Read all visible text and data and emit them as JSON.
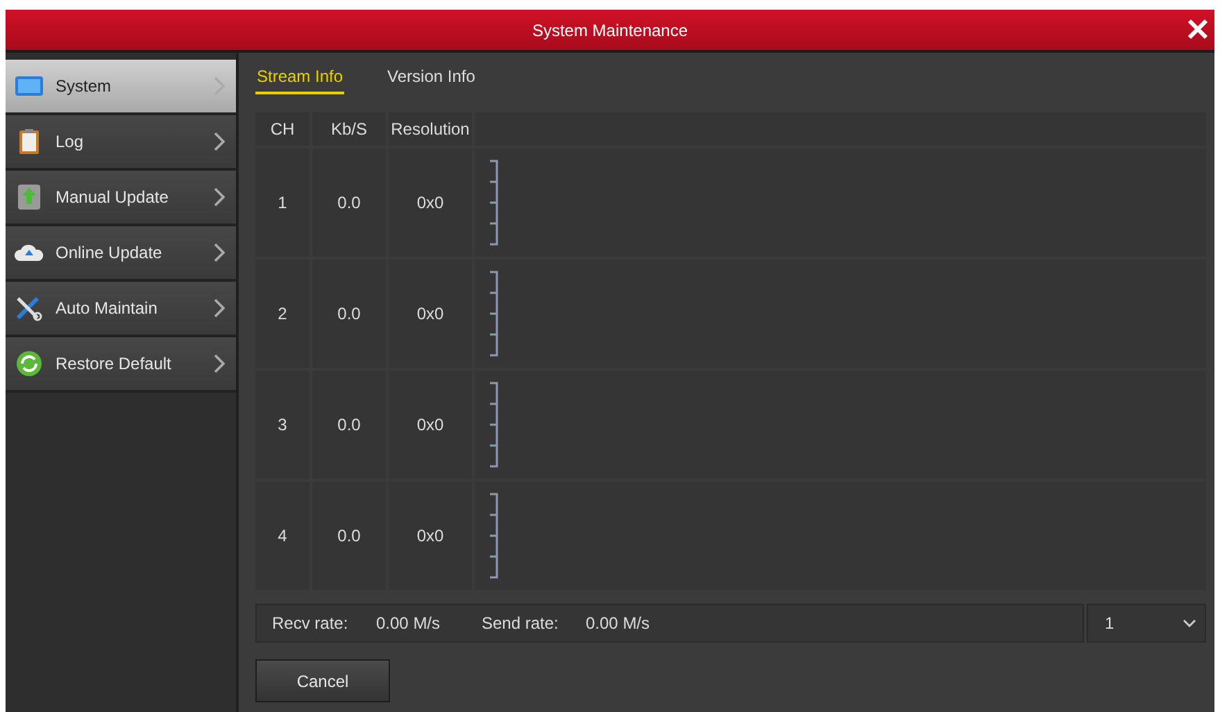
{
  "window": {
    "title": "System Maintenance"
  },
  "sidebar": {
    "items": [
      {
        "label": "System",
        "selected": true
      },
      {
        "label": "Log",
        "selected": false
      },
      {
        "label": "Manual Update",
        "selected": false
      },
      {
        "label": "Online Update",
        "selected": false
      },
      {
        "label": "Auto Maintain",
        "selected": false
      },
      {
        "label": "Restore Default",
        "selected": false
      }
    ]
  },
  "tabs": [
    {
      "label": "Stream Info",
      "selected": true
    },
    {
      "label": "Version Info",
      "selected": false
    }
  ],
  "table": {
    "columns": [
      "CH",
      "Kb/S",
      "Resolution"
    ],
    "rows": [
      {
        "ch": "1",
        "rate": "0.0",
        "resolution": "0x0"
      },
      {
        "ch": "2",
        "rate": "0.0",
        "resolution": "0x0"
      },
      {
        "ch": "3",
        "rate": "0.0",
        "resolution": "0x0"
      },
      {
        "ch": "4",
        "rate": "0.0",
        "resolution": "0x0"
      }
    ]
  },
  "status": {
    "recv_label": "Recv rate:",
    "recv_value": "0.00 M/s",
    "send_label": "Send rate:",
    "send_value": "0.00 M/s",
    "dropdown_value": "1"
  },
  "buttons": [
    "Cancel"
  ]
}
